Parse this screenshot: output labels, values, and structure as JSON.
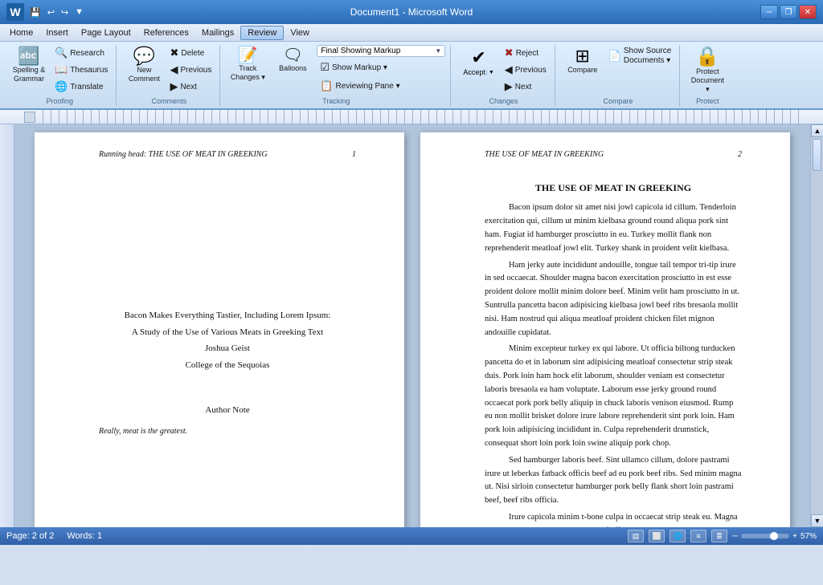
{
  "titlebar": {
    "title": "Document1 - Microsoft Word",
    "word_icon": "W",
    "min": "─",
    "max": "❐",
    "close": "✕"
  },
  "menu": {
    "items": [
      "Home",
      "Insert",
      "Page Layout",
      "References",
      "Mailings",
      "Review",
      "View"
    ]
  },
  "ribbon": {
    "active_tab": "Review",
    "groups": [
      {
        "name": "Proofing",
        "label": "Proofing",
        "items": [
          {
            "id": "spelling",
            "label": "Spelling &\nGrammar",
            "type": "large"
          },
          {
            "id": "research",
            "label": "Research",
            "type": "small"
          },
          {
            "id": "thesaurus",
            "label": "Thesaurus",
            "type": "small"
          },
          {
            "id": "translate",
            "label": "Translate",
            "type": "small"
          }
        ]
      },
      {
        "name": "Comments",
        "label": "Comments",
        "items": [
          {
            "id": "new_comment",
            "label": "New\nComment",
            "type": "large"
          },
          {
            "id": "delete",
            "label": "Delete",
            "type": "small"
          },
          {
            "id": "previous",
            "label": "Previous",
            "type": "small"
          },
          {
            "id": "next",
            "label": "Next",
            "type": "small"
          }
        ]
      },
      {
        "name": "Tracking",
        "label": "Tracking",
        "items": [
          {
            "id": "track_changes",
            "label": "Track\nChanges",
            "type": "large"
          },
          {
            "id": "balloons",
            "label": "Balloons",
            "type": "large"
          },
          {
            "id": "markup_dropdown",
            "label": "Final Showing Markup",
            "type": "dropdown"
          },
          {
            "id": "show_markup",
            "label": "Show Markup ▾",
            "type": "small"
          },
          {
            "id": "reviewing_pane",
            "label": "Reviewing Pane ▾",
            "type": "small"
          }
        ]
      },
      {
        "name": "Changes",
        "label": "Changes",
        "items": [
          {
            "id": "accept",
            "label": "Accept",
            "type": "large-split"
          },
          {
            "id": "reject",
            "label": "Reject",
            "type": "small"
          },
          {
            "id": "previous_change",
            "label": "Previous",
            "type": "small"
          },
          {
            "id": "next_change",
            "label": "Next",
            "type": "small"
          }
        ]
      },
      {
        "name": "Compare",
        "label": "Compare",
        "items": [
          {
            "id": "compare",
            "label": "Compare",
            "type": "large"
          },
          {
            "id": "show_source",
            "label": "Show Source\nDocuments ▾",
            "type": "small"
          }
        ]
      },
      {
        "name": "Protect",
        "label": "Protect",
        "items": [
          {
            "id": "protect_doc",
            "label": "Protect\nDocument ▾",
            "type": "large"
          }
        ]
      }
    ]
  },
  "document": {
    "page1": {
      "header_left": "Running head:  THE USE OF MEAT IN GREEKING",
      "header_right": "1",
      "title": "Bacon Makes Everything Tastier, Including Lorem Ipsum:",
      "subtitle": "A Study of the Use of Various Meats in Greeking Text",
      "author": "Joshua Geist",
      "institution": "College of the Sequoias",
      "author_note_label": "Author Note",
      "footnote": "Really, meat is the greatest."
    },
    "page2": {
      "header_left": "THE USE OF MEAT IN GREEKING",
      "header_right": "2",
      "heading": "THE USE OF MEAT IN GREEKING",
      "paragraphs": [
        "Bacon ipsum dolor sit amet nisi jowl capicola id cillum. Tenderloin exercitation qui, cillum ut minim kielbasa ground round aliqua pork sint ham. Fugiat id hamburger prosciutto in eu. Turkey mollit flank non reprehenderit meatloaf jowl elit. Turkey shank in proident velit kielbasa.",
        "Ham jerky aute incididunt andouille, tongue tail tempor tri-tip irure in sed occaecat. Shoulder magna bacon exercitation prosciutto in est esse proident dolore mollit minim dolore beef. Minim velit ham prosciutto in ut. Suntrulla pancetta bacon adipisicing kielbasa jowl beef ribs bresaola mollit nisi. Ham nostrud qui aliqua meatloaf proident chicken filet mignon andouille cupidatat.",
        "Minim excepteur turkey ex qui labore. Ut officia biltong turducken pancetta do et in laborum sint adipisicing meatloaf consectetur strip steak duis. Pork loin ham hock elit laborum, shoulder veniam est consectetur laboris bresaola ea ham voluptate. Laborum esse jerky ground round occaecat pork pork belly aliquip in chuck laboris venison eiusmod. Rump eu non mollit brisket dolore irure labore reprehenderit sint pork loin. Ham pork loin adipisicing incididunt in. Culpa reprehenderit drumstick, consequat short loin pork loin swine aliquip pork chop.",
        "Sed hamburger laboris beef. Sint ullamco cillum, dolore pastrami irure ut leberkas fatback officis beef ad eu pork beef ribs. Sed minim magna ut. Nisi sirloin consectetur hamburger pork belly flank short loin pastrami beef, beef ribs officia.",
        "Irure capicola minim t-bone culpa in occaecat strip steak eu. Magna hamburger swine cillum corned beef officia duis ut prosciutto. Filet mignon pariatur spare ribs, sirloin corned beef adipisicing culpa meatball turducken cow shank do. Magna brisket esse venison."
      ]
    }
  },
  "statusbar": {
    "page_info": "Page: 2 of 2",
    "word_count": "Words: 1",
    "zoom": "57%"
  }
}
